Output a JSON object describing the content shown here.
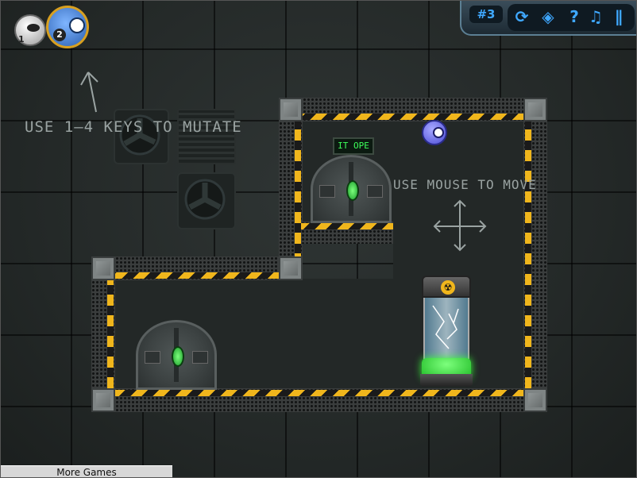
{
  "hud": {
    "level_label": "#3",
    "buttons": [
      {
        "name": "restart-icon",
        "glyph": "⟳"
      },
      {
        "name": "gamepad-icon",
        "glyph": "◈"
      },
      {
        "name": "help-icon",
        "glyph": "?"
      },
      {
        "name": "music-icon",
        "glyph": "♫"
      },
      {
        "name": "pause-icon",
        "glyph": "∥"
      }
    ],
    "mutations": [
      {
        "number": "1",
        "name": "white-blob"
      },
      {
        "number": "2",
        "name": "blue-blob"
      }
    ]
  },
  "hints": {
    "mutate": "Use 1–4 keys to mutate",
    "move": "Use mouse to move"
  },
  "door_sign": "IT OPE",
  "footer": {
    "more_games": "More Games"
  },
  "colors": {
    "hazard_yellow": "#f0b61c",
    "hud_blue": "#3fa8ff",
    "goo_green": "#39ff3a"
  }
}
